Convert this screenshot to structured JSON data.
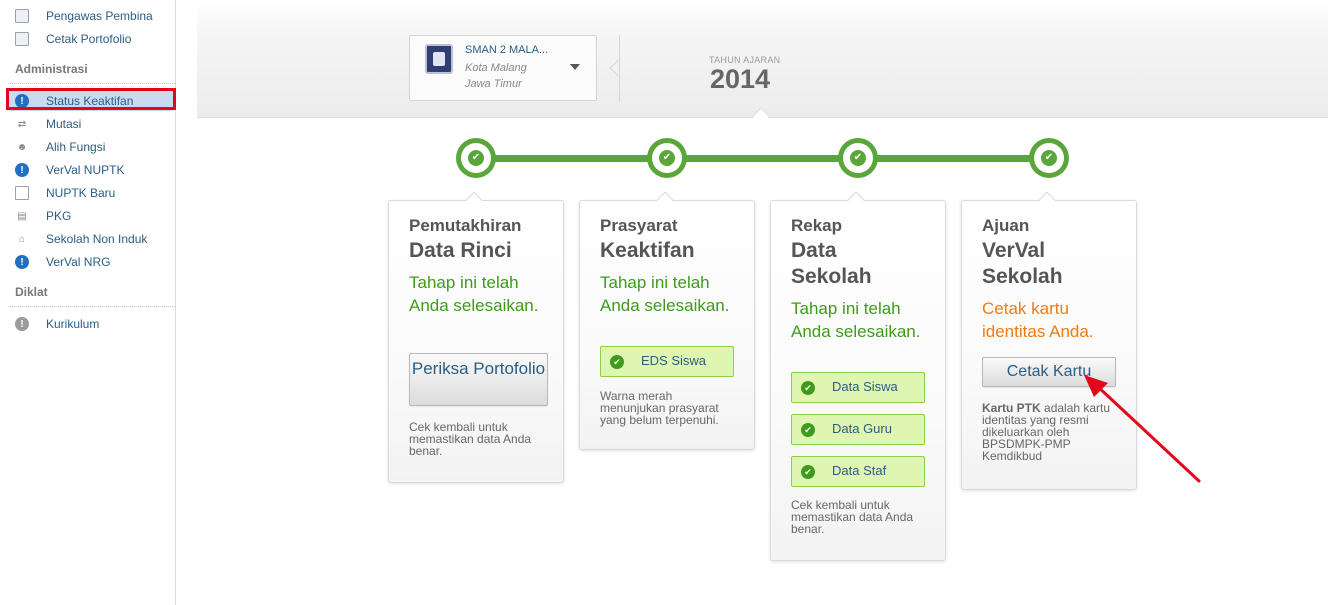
{
  "sidebar": {
    "items_top": [
      {
        "label": "Pengawas Pembina",
        "icon": "document-icon"
      },
      {
        "label": "Cetak Portofolio",
        "icon": "document-icon"
      }
    ],
    "section_admin": "Administrasi",
    "items_admin": [
      {
        "label": "Status Keaktifan",
        "icon": "alert-icon"
      },
      {
        "label": "Mutasi",
        "icon": "transfer-icon"
      },
      {
        "label": "Alih Fungsi",
        "icon": "person-icon"
      },
      {
        "label": "VerVal NUPTK",
        "icon": "alert-icon"
      },
      {
        "label": "NUPTK Baru",
        "icon": "new-document-icon"
      },
      {
        "label": "PKG",
        "icon": "chart-icon"
      },
      {
        "label": "Sekolah Non Induk",
        "icon": "house-icon"
      },
      {
        "label": "VerVal NRG",
        "icon": "alert-icon"
      }
    ],
    "section_diklat": "Diklat",
    "items_diklat": [
      {
        "label": "Kurikulum",
        "icon": "gray-alert-icon"
      }
    ]
  },
  "header": {
    "school_name": "SMAN 2 MALA...",
    "school_city": "Kota Malang",
    "school_province": "Jawa Timur",
    "year_label": "TAHUN AJARAN",
    "year_value": "2014"
  },
  "steps": [
    {
      "sub": "Pemutakhiran",
      "main": "Data Rinci",
      "status": "Tahap ini telah Anda selesaikan.",
      "button": "Periksa Portofolio",
      "note": "Cek kembali untuk memastikan data Anda benar."
    },
    {
      "sub": "Prasyarat",
      "main": "Keaktifan",
      "status": "Tahap ini telah Anda selesaikan.",
      "badges": [
        "EDS Siswa"
      ],
      "note": "Warna merah menunjukan prasyarat yang belum terpenuhi."
    },
    {
      "sub": "Rekap",
      "main_line1": "Data",
      "main_line2": "Sekolah",
      "status": "Tahap ini telah Anda selesaikan.",
      "badges": [
        "Data Siswa",
        "Data Guru",
        "Data Staf"
      ],
      "note": "Cek kembali untuk memastikan data Anda benar."
    },
    {
      "sub": "Ajuan",
      "main_line1": "VerVal",
      "main_line2": "Sekolah",
      "status": "Cetak kartu identitas Anda.",
      "button": "Cetak Kartu",
      "note_bold": "Kartu PTK",
      "note": "adalah kartu identitas yang resmi dikeluarkan oleh BPSDMPK-PMP Kemdikbud"
    }
  ],
  "colors": {
    "green": "#5aa63a",
    "highlight_red": "#e3071b",
    "link_blue": "#2a5d84",
    "orange": "#f07a13"
  }
}
